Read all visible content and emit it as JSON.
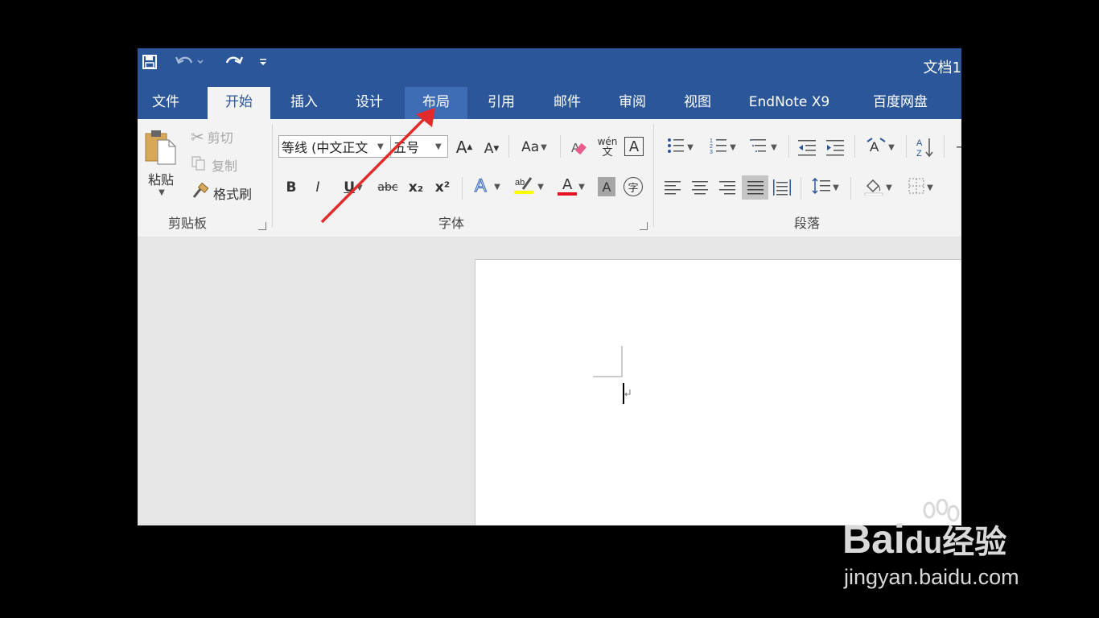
{
  "title_bar": {
    "doc_title": "文档1"
  },
  "tabs": [
    {
      "id": "file",
      "label": "文件"
    },
    {
      "id": "home",
      "label": "开始"
    },
    {
      "id": "insert",
      "label": "插入"
    },
    {
      "id": "design",
      "label": "设计"
    },
    {
      "id": "layout",
      "label": "布局"
    },
    {
      "id": "references",
      "label": "引用"
    },
    {
      "id": "mailings",
      "label": "邮件"
    },
    {
      "id": "review",
      "label": "审阅"
    },
    {
      "id": "view",
      "label": "视图"
    },
    {
      "id": "endnote",
      "label": "EndNote X9"
    },
    {
      "id": "baidu",
      "label": "百度网盘"
    }
  ],
  "clipboard": {
    "paste_label": "粘贴",
    "cut_label": "剪切",
    "copy_label": "复制",
    "format_painter_label": "格式刷",
    "group_label": "剪贴板"
  },
  "font": {
    "font_name": "等线 (中文正文",
    "font_size": "五号",
    "change_case": "Aa",
    "phonetic_top": "wén",
    "phonetic_bottom": "文",
    "char_border": "A",
    "bold": "B",
    "italic": "I",
    "underline": "U",
    "strikethrough": "abc",
    "subscript": "x₂",
    "superscript": "x²",
    "font_color_letter": "A",
    "char_shading": "A",
    "enclose_char": "字",
    "group_label": "字体",
    "highlight_color": "#ffff00",
    "font_color": "#e81123"
  },
  "paragraph": {
    "group_label": "段落"
  },
  "colors": {
    "accent": "#2b579a",
    "annotation_arrow": "#e32b2b"
  },
  "watermark": {
    "brand": "Bai",
    "brand_suffix": "经验",
    "url": "jingyan.baidu.com"
  }
}
